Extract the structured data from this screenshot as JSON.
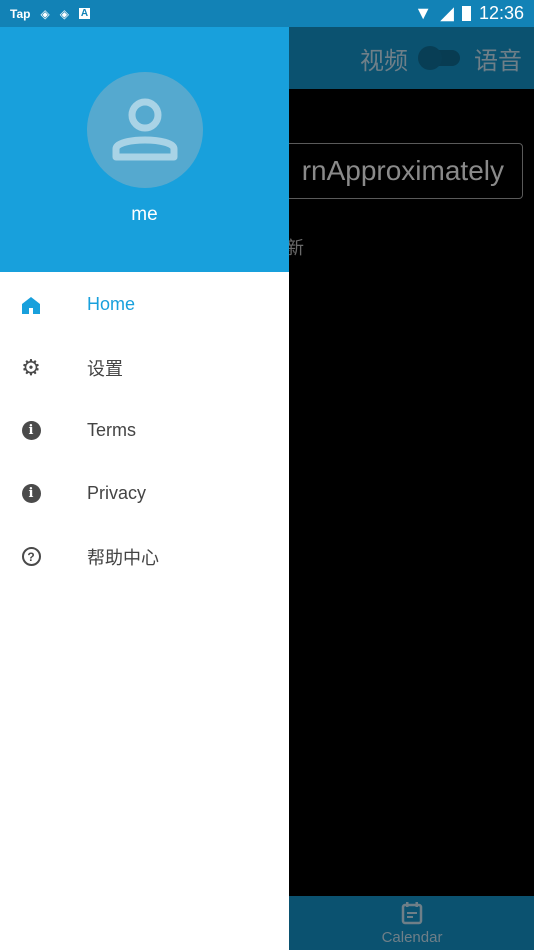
{
  "status_bar": {
    "left_badge": "Tap",
    "time": "12:36",
    "icons": [
      "tap-app-icon",
      "sync-app-icon",
      "sync-app-icon",
      "a-app-icon",
      "wifi-icon",
      "signal-icon",
      "battery-charging-icon"
    ]
  },
  "app_bar": {
    "left_label": "视频",
    "right_label": "语音",
    "toggle_on": false
  },
  "background": {
    "button_text": "rnApproximately",
    "sub_text": "新"
  },
  "bottom_nav": {
    "items": [
      {
        "label": "Calendar",
        "icon": "calendar-icon"
      }
    ]
  },
  "drawer": {
    "user_name": "me",
    "items": [
      {
        "label": "Home",
        "icon": "home-icon",
        "active": true
      },
      {
        "label": "设置",
        "icon": "gear-icon"
      },
      {
        "label": "Terms",
        "icon": "info-icon"
      },
      {
        "label": "Privacy",
        "icon": "info-icon"
      },
      {
        "label": "帮助中心",
        "icon": "help-icon"
      }
    ]
  },
  "colors": {
    "accent": "#18a0dc",
    "status_bar": "#1282b6",
    "scrim_bar": "#0b5270"
  }
}
